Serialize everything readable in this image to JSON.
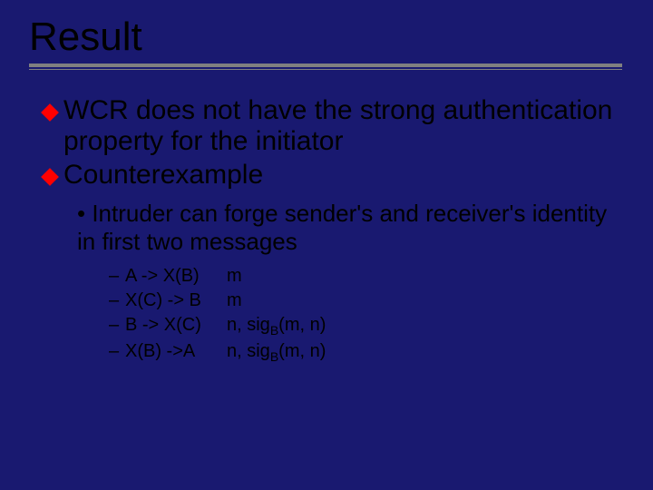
{
  "title": "Result",
  "bullets": {
    "b1": "WCR does not have the strong authentication property for the initiator",
    "b2": "Counterexample"
  },
  "sub": {
    "s1": "Intruder can forge sender's and receiver's identity in first two messages"
  },
  "msgs": {
    "m1": {
      "left": "A -> X(B)",
      "right": "m"
    },
    "m2": {
      "left": "X(C) -> B",
      "right": "m"
    },
    "m3": {
      "left": "B -> X(C)",
      "right_pre": "n, sig",
      "right_sub": "B",
      "right_post": "(m, n)"
    },
    "m4": {
      "left": "X(B) ->A",
      "right_pre": "n, sig",
      "right_sub": "B",
      "right_post": "(m, n)"
    }
  },
  "dash": "–"
}
